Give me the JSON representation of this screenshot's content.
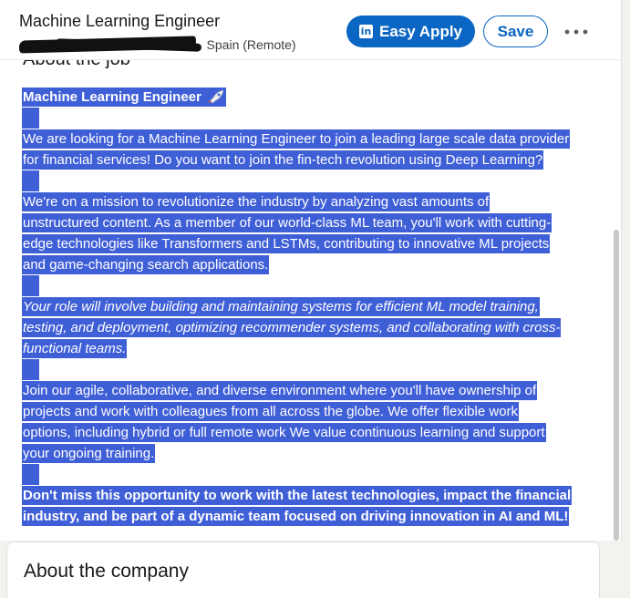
{
  "header": {
    "job_title": "Machine Learning Engineer",
    "location": "· Spain (Remote)",
    "easy_apply_label": "Easy Apply",
    "linkedin_logo_text": "in",
    "save_label": "Save",
    "more_icon": "ellipsis-horizontal-icon",
    "underlying_heading": "About the job"
  },
  "description": {
    "heading": "Machine Learning Engineer",
    "heading_icon": "rocket-icon",
    "p1": [
      "We are looking for a Machine Learning Engineer to join a leading large scale data provider",
      "for financial services! Do you want to join the fin-tech revolution using Deep Learning?"
    ],
    "p2": [
      "We're on a mission to revolutionize the industry by analyzing vast amounts of",
      "unstructured content. As a member of our world-class ML team, you'll work with cutting-",
      "edge technologies like Transformers and LSTMs, contributing to innovative ML projects",
      "and game-changing search applications."
    ],
    "p3": [
      "Your role will involve building and maintaining systems for efficient ML model training,",
      "testing, and deployment, optimizing recommender systems, and collaborating with cross-",
      "functional teams."
    ],
    "p4": [
      "Join our agile, collaborative, and diverse environment where you'll have ownership of",
      "projects and work with colleagues from all across the globe. We offer flexible work",
      "options, including hybrid or full remote work We value continuous learning and support",
      "your ongoing training."
    ],
    "p5": [
      "Don't miss this opportunity to work with the latest technologies, impact the financial",
      "industry, and be part of a dynamic team focused on driving innovation in AI and ML!"
    ]
  },
  "company": {
    "heading": "About the company"
  },
  "colors": {
    "brand_blue": "#0a66c2",
    "selection": "#3f5fd7",
    "background": "#f3f2ef"
  }
}
